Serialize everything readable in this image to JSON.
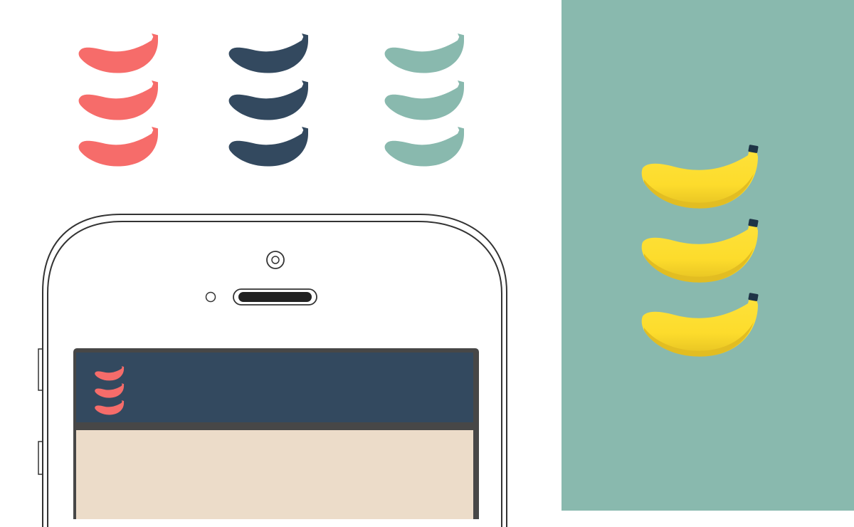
{
  "logo_variants": [
    {
      "name": "coral",
      "color": "#f66c6a"
    },
    {
      "name": "navy",
      "color": "#33495f"
    },
    {
      "name": "teal",
      "color": "#89b9ae"
    }
  ],
  "colors": {
    "panel_background": "#89b9ae",
    "banana_yellow": "#fddc2c",
    "banana_shade": "#e5c122",
    "banana_stem": "#1f3447",
    "phone_outline": "#333333",
    "app_header": "#33495f",
    "app_body": "#ecdcc9",
    "app_frame": "#474747",
    "app_logo": "#f66c6a"
  },
  "icons": {
    "logo": "banana-stack-icon",
    "camera": "camera-icon",
    "speaker": "speaker-icon",
    "sensor": "sensor-icon"
  }
}
